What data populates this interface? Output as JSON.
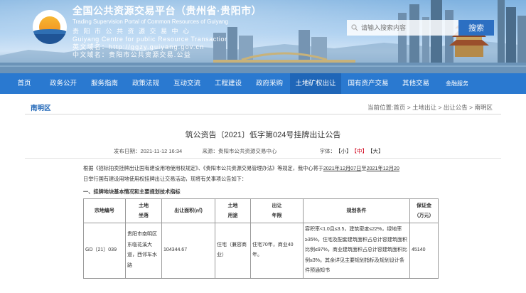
{
  "header": {
    "title": "全国公共资源交易平台（贵州省·贵阳市）",
    "subtitle_en": "Trading Supervision Portal of Common Resources of Guiyang",
    "cn_name": "贵 阳 市 公 共 资 源 交 易 中 心",
    "en_name": "Guiyang Centre for public Resource Transactior",
    "en_domain": "英文域名：http://ggzy.guiyang.gov.cn",
    "cn_domain": "中文域名：贵阳市公共资源交易.公益",
    "search_placeholder": "请输入搜索内容",
    "search_button": "搜索"
  },
  "nav": {
    "items": [
      {
        "label": "首页"
      },
      {
        "label": "政务公开"
      },
      {
        "label": "服务指南"
      },
      {
        "label": "政策法规"
      },
      {
        "label": "互动交流"
      },
      {
        "label": "工程建设"
      },
      {
        "label": "政府采购"
      },
      {
        "label": "土地矿权出让"
      },
      {
        "label": "国有资产交易"
      },
      {
        "label": "其他交易"
      },
      {
        "label": "金融服务"
      }
    ]
  },
  "section": {
    "title": "南明区",
    "breadcrumb_prefix": "当前位置:",
    "crumbs": [
      "首页",
      "土地出让",
      "出让公告",
      "南明区"
    ]
  },
  "document": {
    "title": "筑公资告〔2021〕低字第024号挂牌出让公告",
    "publish_date": "发布日期：2021-11-12 16:34",
    "source": "来源：贵阳市公共资源交易中心",
    "font_label": "字体：",
    "font_small": "【小】",
    "font_medium": "【中】",
    "font_large": "【大】",
    "para1_a": "根据《招标拍卖挂牌出让国有建设用地使用权规定》、《贵阳市公共资源交易管理办法》等规定，我中心将于",
    "para1_date1": "2021年12月07日",
    "para1_mid": "至",
    "para1_date2": "2021年12月20",
    "para2_a": "日",
    "para2_b": "举行国有建设用地使用权挂牌出让交易活动，现将有关事项公告如下：",
    "section_heading": "一、挂牌地块基本情况和主要规划技术指标"
  },
  "table": {
    "headers": {
      "parcel_no": "宗地编号",
      "location_1": "土地",
      "location_2": "坐落",
      "area": "出让面积(㎡)",
      "use_1": "土地",
      "use_2": "用途",
      "term_1": "出让",
      "term_2": "年限",
      "conditions": "规划条件",
      "deposit_1": "保证金",
      "deposit_2": "（万元）"
    },
    "rows": [
      {
        "parcel_no": "GD〔21〕039",
        "location": "贵阳市南明区东临花溪大道，西邻车水路",
        "area": "104344.67",
        "use": "住宅（兼容商业）",
        "term": "住宅70年，商业40年。",
        "conditions_a": "容积率<1.0且≤3.5，建筑密度≤22%，绿地率≥35%，住宅及配套建筑面积占总计容建筑面积比例≤97%，商业建筑面积占总计容建筑面积比例≤3%。其余详见主要规划指标及规划设计条件预通知书",
        "deposit": "45140"
      }
    ]
  }
}
